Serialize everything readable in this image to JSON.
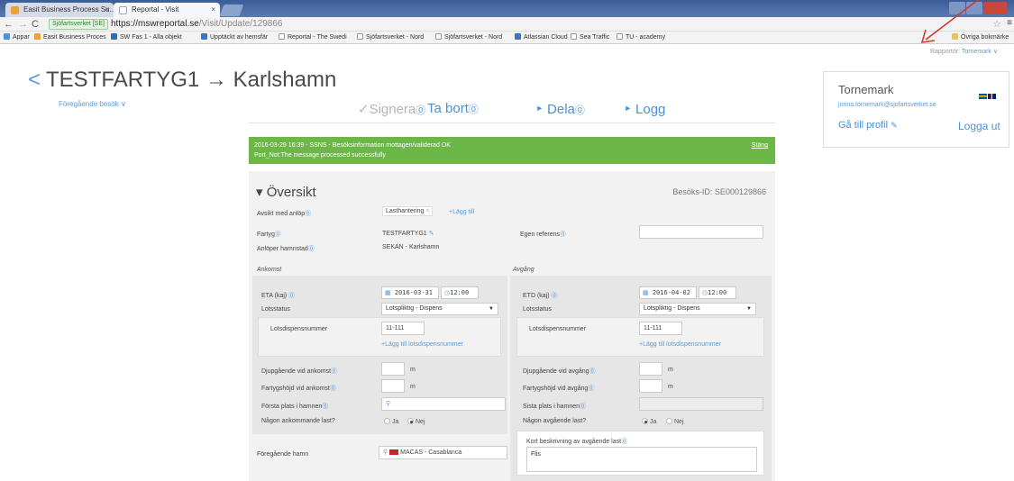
{
  "browser": {
    "tabs": [
      {
        "label": "Easit Business Process Su...",
        "favicon_color": "#e8a33a"
      },
      {
        "label": "Reportal - Visit",
        "favicon_color": "#9aa5b8"
      }
    ],
    "url_secure_label": "Sjöfartsverket [SE]",
    "url_host": "https://mswreportal.se",
    "url_path": "/Visit/Update/129866",
    "bookmarks": [
      "Appar",
      "Easit Business Proces",
      "SW Fas 1 - Alla objekt",
      "Upptäckt av hemsfär",
      "Reportal - The Swedi",
      "Sjöfartsverket - Nord",
      "Sjöfartsverket - Nord",
      "Atlassian Cloud",
      "Sea Traffic",
      "TU - academy",
      "Övriga bokmärke"
    ]
  },
  "header": {
    "back_glyph": "<",
    "title": "TESTFARTYG1 → Karlshamn",
    "previous_visit": "Föregående besök ∨",
    "reporter_prefix": "Rapportör:",
    "reporter_name": "Tornemark ∨"
  },
  "actions": {
    "sign": "✓Signera",
    "delete": "Ta bort",
    "share": "‣ Dela",
    "log": "‣ Logg"
  },
  "profile": {
    "name": "Tornemark",
    "email": "jonna.tornemark@sjofartsverket.se",
    "profile_link": "Gå till profil",
    "logout": "Logga ut"
  },
  "message": {
    "line1": "2016-03-29 16:39 - SSNS - Besöksinformation mottagen/validerad OK",
    "line2": "Port_Not:The message processed successfully",
    "close": "Stäng"
  },
  "overview": {
    "title": "▾ Översikt",
    "visit_id": "Besöks-ID: SE000129866",
    "purpose_label": "Avsikt med anlöp",
    "purpose_tag": "Lasthantering",
    "add_link": "+Lägg till",
    "ship_label": "Fartyg",
    "ship_value": "TESTFARTYG1",
    "port_label": "Anlöper hamnstad",
    "port_value": "SEKAN - Karlshamn",
    "own_ref_label": "Egen referens",
    "own_ref_value": ""
  },
  "arrival": {
    "heading": "Ankomst",
    "eta_label": "ETA (kaj)",
    "eta_date": "2016-03-31",
    "eta_time": "12:00",
    "pilot_label": "Lotsstatus",
    "pilot_value": "Lotspliktig - Dispens",
    "dispensation_label": "Lotsdispensnummer",
    "dispensation_value": "11-111",
    "add_dispensation": "+Lägg till lotsdispensnummer",
    "draught_label": "Djupgående vid ankomst",
    "height_label": "Fartygshöjd vid ankomst",
    "unit": "m",
    "first_place_label": "Första plats i hamnen",
    "cargo_label": "Någon ankommande last?",
    "yes": "Ja",
    "no": "Nej",
    "prev_port_label": "Föregående hamn",
    "prev_port_value": "MACAS - Casablanca"
  },
  "departure": {
    "heading": "Avgång",
    "etd_label": "ETD (kaj)",
    "etd_date": "2016-04-02",
    "etd_time": "12:00",
    "pilot_label": "Lotsstatus",
    "pilot_value": "Lotspliktig - Dispens",
    "dispensation_label": "Lotsdispensnummer",
    "dispensation_value": "11-111",
    "add_dispensation": "+Lägg till lotsdispensnummer",
    "draught_label": "Djupgående vid avgång",
    "height_label": "Fartygshöjd vid avgång",
    "unit": "m",
    "last_place_label": "Sista plats i hamnen",
    "cargo_label": "Någon avgående last?",
    "yes": "Ja",
    "no": "Nej",
    "cargo_desc_label": "Kort beskrivning av avgående last",
    "cargo_desc_value": "Flis"
  },
  "colors": {
    "accent_blue": "#4a90d9",
    "success_green": "#6db648",
    "annotation_red": "#d0342c"
  }
}
